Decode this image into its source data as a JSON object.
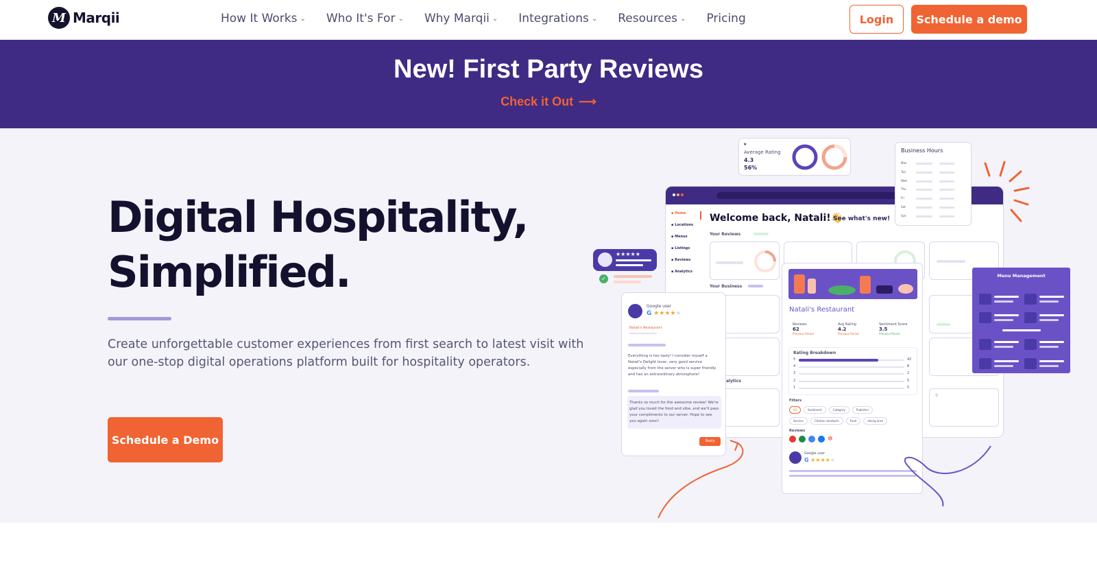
{
  "brand": {
    "name": "Marqii",
    "mark": "M"
  },
  "nav": {
    "items": [
      {
        "label": "How It Works",
        "has_dropdown": true
      },
      {
        "label": "Who It's For",
        "has_dropdown": true
      },
      {
        "label": "Why Marqii",
        "has_dropdown": true
      },
      {
        "label": "Integrations",
        "has_dropdown": true
      },
      {
        "label": "Resources",
        "has_dropdown": true
      },
      {
        "label": "Pricing",
        "has_dropdown": false
      }
    ],
    "login_label": "Login",
    "demo_label": "Schedule a demo"
  },
  "banner": {
    "title": "New! First Party Reviews",
    "link_label": "Check it Out",
    "link_arrow": "⟶"
  },
  "hero": {
    "title_line1": "Digital Hospitality,",
    "title_line2": "Simplified.",
    "subtitle": "Create unforgettable customer experiences from first search to latest visit with our one-stop digital operations platform built for hospitality operators.",
    "cta_label": "Schedule a Demo"
  },
  "mockup": {
    "avg_rating_label": "Average Rating",
    "avg_rating_value": "4.3",
    "recommended_value": "56%",
    "business_hours_label": "Business Hours",
    "days": [
      "Mon",
      "Tue",
      "Wed",
      "Thu",
      "Fri",
      "Sat",
      "Sun"
    ],
    "sidebar": [
      "Home",
      "Locations",
      "Menus",
      "Listings",
      "Reviews",
      "Analytics"
    ],
    "welcome": "Welcome back, Natali!👋",
    "whats_new": "See what's new!",
    "your_reviews": "Your Reviews",
    "your_business": "Your Business",
    "analytics_partial": "alytics",
    "review_user": "Google user",
    "review_place": "Natali's Restaurant",
    "review_text": "Everything is too tasty! I consider myself a Natali's Delight lover, very good service especially from the server who is super friendly and has an extraordinary atmosphere!",
    "reply_text": "Thanks so much for the awesome review! We're glad you loved the food and vibe, and we'll pass your compliments to our server. Hope to see you again soon!",
    "reply_button": "Reply",
    "restaurant_name": "Natali's Restaurant",
    "stats": [
      {
        "label": "Reviews",
        "value": "62",
        "sub": "55",
        "footer": "Previous Period"
      },
      {
        "label": "Avg Rating",
        "value": "4.2",
        "sub": "4.5",
        "footer": "Previous Period"
      },
      {
        "label": "Sentiment Score",
        "value": "3.5",
        "sub": "4.5",
        "footer": "Previous Period"
      }
    ],
    "rating_breakdown_label": "Rating Breakdown",
    "breakdown": [
      {
        "star": "5",
        "count": "42",
        "fill": 0.75
      },
      {
        "star": "4",
        "count": "8",
        "fill": 0
      },
      {
        "star": "3",
        "count": "2",
        "fill": 0
      },
      {
        "star": "2",
        "count": "5",
        "fill": 0
      },
      {
        "star": "1",
        "count": "5",
        "fill": 0
      }
    ],
    "filters_label": "Filters",
    "filter_chips": [
      "All",
      "Sentiment",
      "Category",
      "Publisher"
    ],
    "tag_chips": [
      "Service",
      "Chicken sandwich",
      "Food",
      "dining area"
    ],
    "reviews_label": "Reviews",
    "menu_management_label": "Menu Management",
    "colors": {
      "accent": "#f06332",
      "purple": "#3f2b84",
      "violet": "#6a52c6"
    }
  }
}
